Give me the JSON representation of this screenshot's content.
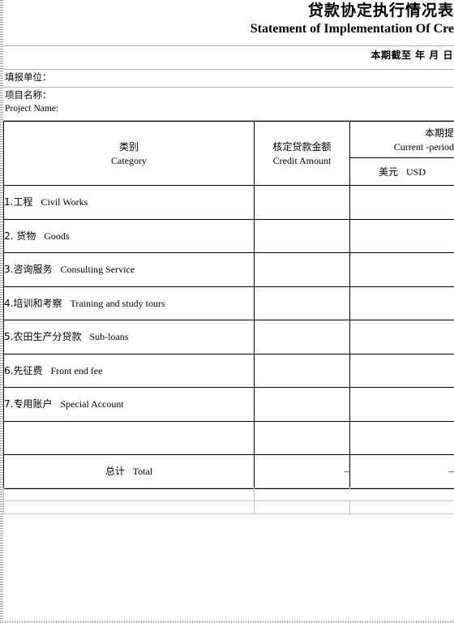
{
  "document": {
    "title_cn": "贷款协定执行情况表",
    "title_en": "Statement of Implementation Of Cre",
    "as_of": "本期截至  年 月 日",
    "reporting_unit_label": "填报单位：",
    "project_name_label_cn": "项目名称：",
    "project_name_label_en": "Project Name:"
  },
  "table": {
    "headers": {
      "category_cn": "类别",
      "category_en": "Category",
      "credit_amount_cn": "核定贷款金额",
      "credit_amount_en": "Credit Amount",
      "current_period_cn": "本期提",
      "current_period_en": "Current -period",
      "currency_cn": "美元",
      "currency_en": "USD"
    },
    "rows": [
      {
        "cn": "1.工程",
        "en": "Civil Works",
        "credit_amount": "",
        "usd": ""
      },
      {
        "cn": "2. 货物",
        "en": "Goods",
        "credit_amount": "",
        "usd": ""
      },
      {
        "cn": "3.咨询服务",
        "en": "Consulting Service",
        "credit_amount": "",
        "usd": ""
      },
      {
        "cn": "4.培训和考察",
        "en": "Training and study tours",
        "credit_amount": "",
        "usd": ""
      },
      {
        "cn": "5.农田生产分贷款",
        "en": "Sub-loans",
        "credit_amount": "",
        "usd": ""
      },
      {
        "cn": "6.先征费",
        "en": "Front end fee",
        "credit_amount": "",
        "usd": ""
      },
      {
        "cn": "7.专用账户",
        "en": "Special Account",
        "credit_amount": "",
        "usd": ""
      },
      {
        "cn": "",
        "en": "",
        "credit_amount": "",
        "usd": ""
      }
    ],
    "total": {
      "label_cn": "总计",
      "label_en": "Total",
      "credit_amount": "–",
      "usd": "–"
    }
  }
}
